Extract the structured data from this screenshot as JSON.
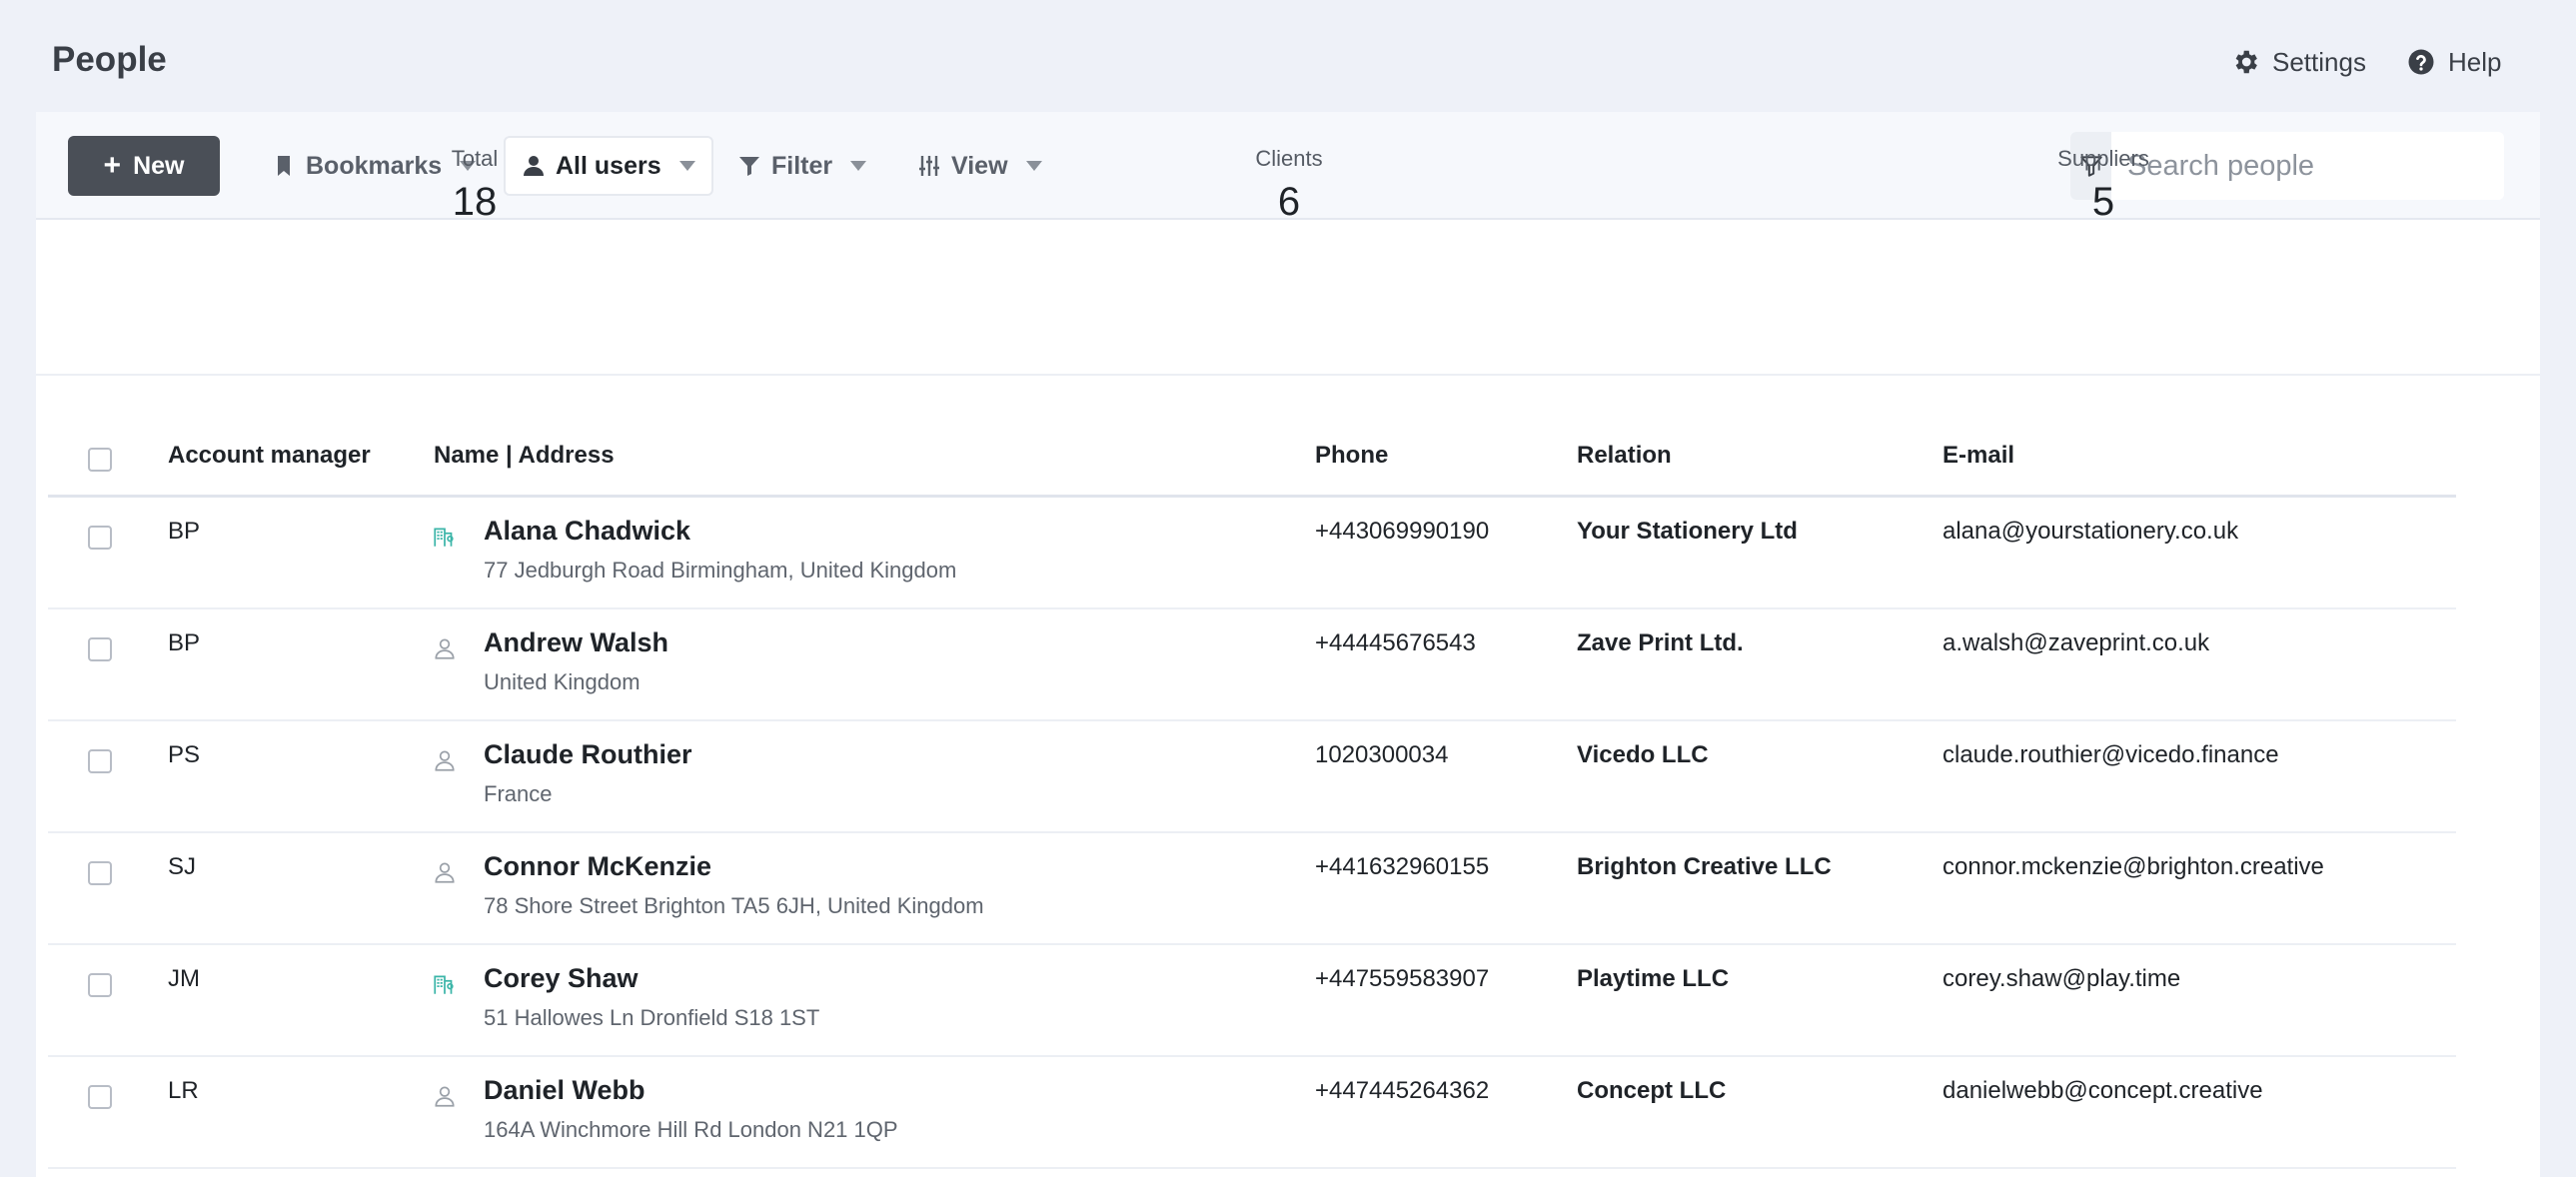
{
  "header": {
    "title": "People",
    "settings_label": "Settings",
    "help_label": "Help"
  },
  "toolbar": {
    "new_label": "New",
    "bookmarks_label": "Bookmarks",
    "users_label": "All users",
    "filter_label": "Filter",
    "view_label": "View",
    "search_placeholder": "Search people"
  },
  "stats": [
    {
      "label": "Total",
      "value": "18"
    },
    {
      "label": "Clients",
      "value": "6"
    },
    {
      "label": "Suppliers",
      "value": "5"
    }
  ],
  "table": {
    "columns": [
      "Account manager",
      "Name | Address",
      "Phone",
      "Relation",
      "E-mail"
    ],
    "rows": [
      {
        "manager": "BP",
        "icon": "company-icon",
        "name": "Alana Chadwick",
        "address": "77 Jedburgh Road Birmingham, United Kingdom",
        "phone": "+443069990190",
        "relation": "Your Stationery Ltd",
        "email": "alana@yourstationery.co.uk"
      },
      {
        "manager": "BP",
        "icon": "person-icon",
        "name": "Andrew Walsh",
        "address": "United Kingdom",
        "phone": "+44445676543",
        "relation": "Zave Print Ltd.",
        "email": "a.walsh@zaveprint.co.uk"
      },
      {
        "manager": "PS",
        "icon": "person-icon",
        "name": "Claude Routhier",
        "address": "France",
        "phone": "1020300034",
        "relation": "Vicedo LLC",
        "email": "claude.routhier@vicedo.finance"
      },
      {
        "manager": "SJ",
        "icon": "person-icon",
        "name": "Connor McKenzie",
        "address": "78 Shore Street Brighton TA5 6JH, United Kingdom",
        "phone": "+441632960155",
        "relation": "Brighton Creative LLC",
        "email": "connor.mckenzie@brighton.creative"
      },
      {
        "manager": "JM",
        "icon": "company-icon",
        "name": "Corey Shaw",
        "address": "51 Hallowes Ln Dronfield S18 1ST",
        "phone": "+447559583907",
        "relation": "Playtime LLC",
        "email": "corey.shaw@play.time"
      },
      {
        "manager": "LR",
        "icon": "person-icon",
        "name": "Daniel Webb",
        "address": "164A Winchmore Hill Rd London N21 1QP",
        "phone": "+447445264362",
        "relation": "Concept LLC",
        "email": "danielwebb@concept.creative"
      }
    ]
  },
  "colors": {
    "accent": "#4a4f57",
    "company_icon": "#3bb5a8",
    "person_icon": "#9aa0a8"
  }
}
